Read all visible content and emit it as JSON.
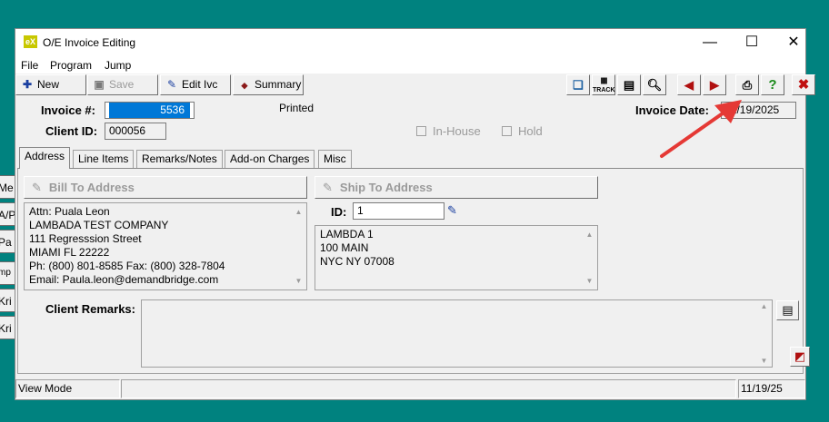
{
  "background_buttons": [
    "Me",
    "A/P",
    "Pa",
    "mp",
    "Kri",
    "Kri"
  ],
  "window": {
    "title": "O/E Invoice Editing",
    "app_icon_text": "eX",
    "controls": {
      "minimize": "—",
      "maximize": "☐",
      "close": "✕"
    }
  },
  "menu": [
    "File",
    "Program",
    "Jump"
  ],
  "toolbar": {
    "new_label": "New",
    "save_label": "Save",
    "edit_label": "Edit Ivc",
    "summary_label": "Summary",
    "track_label": "TRACK"
  },
  "header": {
    "invoice_label": "Invoice #:",
    "invoice_value": "5536",
    "status_text": "Printed",
    "invoice_date_label": "Invoice Date:",
    "invoice_date_value": "11/19/2025",
    "client_label": "Client ID:",
    "client_value": "000056",
    "in_house_label": "In-House",
    "hold_label": "Hold"
  },
  "tabs": [
    "Address",
    "Line Items",
    "Remarks/Notes",
    "Add-on Charges",
    "Misc"
  ],
  "address": {
    "bill_to_label": "Bill To Address",
    "bill_to_lines": [
      "Attn: Puala Leon",
      "LAMBADA  TEST COMPANY",
      "111 Regresssion Street",
      "MIAMI  FL    22222",
      "Ph: (800) 801-8585  Fax: (800) 328-7804",
      "Email: Paula.leon@demandbridge.com"
    ],
    "ship_to_label": "Ship To Address",
    "ship_id_label": "ID:",
    "ship_id_value": "1",
    "ship_to_lines": [
      "LAMBDA 1",
      "100 MAIN",
      "NYC  NY    07008"
    ],
    "client_remarks_label": "Client Remarks:",
    "client_remarks_value": ""
  },
  "statusbar": {
    "mode": "View Mode",
    "middle": "",
    "date": "11/19/25"
  },
  "colors": {
    "background": "#00827f",
    "selection": "#0078d7",
    "arrow": "#e53935"
  }
}
